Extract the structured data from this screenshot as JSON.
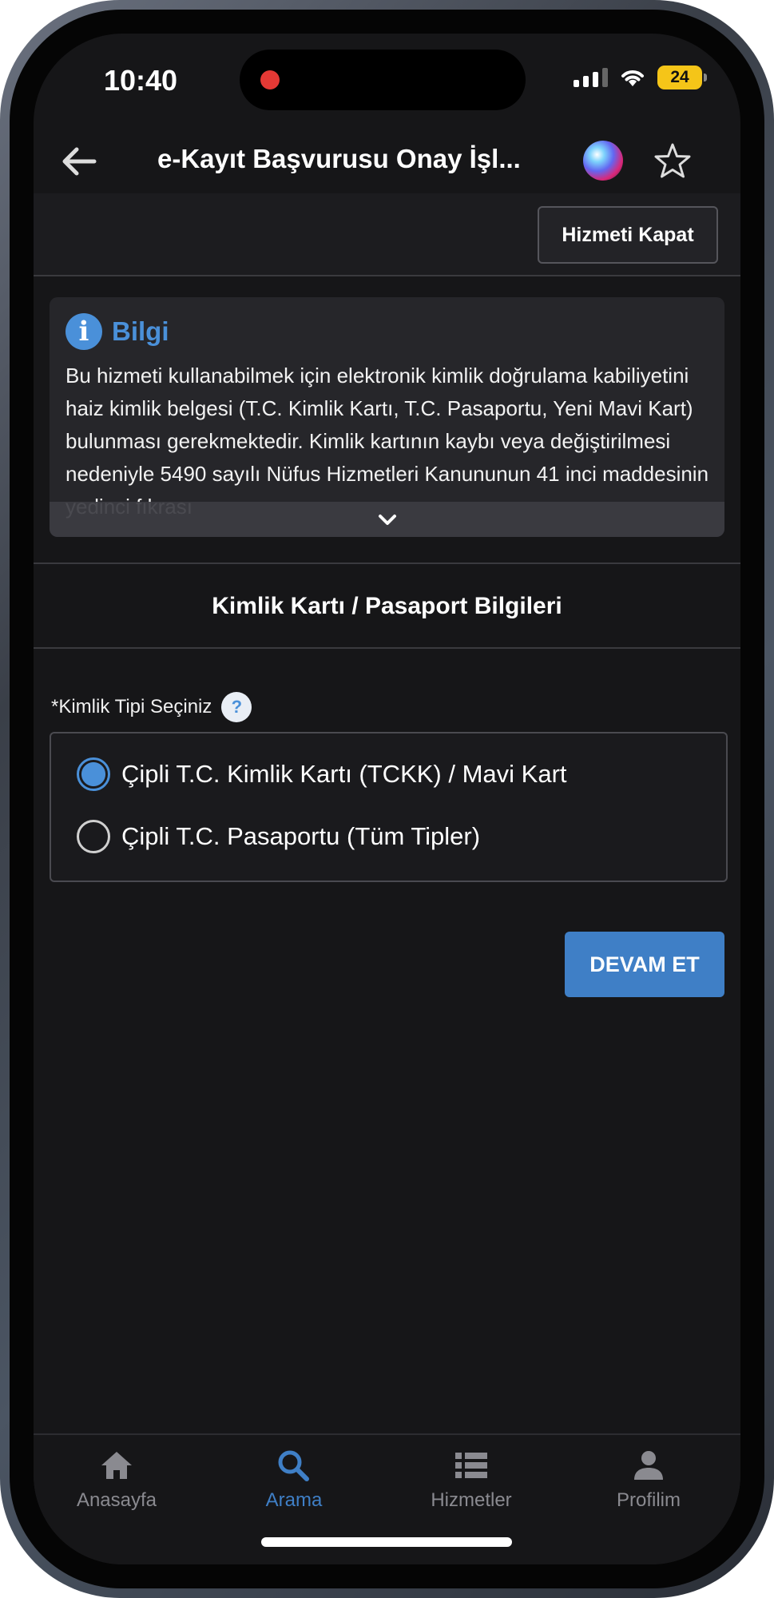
{
  "status_bar": {
    "time": "10:40",
    "battery": "24",
    "recording_indicator_color": "#e53935"
  },
  "header": {
    "title": "e-Kayıt Başvurusu Onay İşl...",
    "back_icon": "arrow-left-icon",
    "assistant_icon": "siri-orb-icon",
    "favorite_icon": "star-outline-icon"
  },
  "toolbar": {
    "close_service_label": "Hizmeti Kapat"
  },
  "info_card": {
    "title": "Bilgi",
    "icon": "info-icon",
    "text": "Bu hizmeti kullanabilmek için elektronik kimlik doğrulama kabiliyetini haiz kimlik belgesi (T.C. Kimlik Kartı, T.C. Pasaportu, Yeni Mavi Kart) bulunması gerekmektedir. Kimlik kartının kaybı veya değiştirilmesi nedeniyle 5490 sayılı Nüfus Hizmetleri Kanununun 41 inci maddesinin yedinci fıkrası",
    "expand_icon": "chevron-down-icon"
  },
  "section": {
    "title": "Kimlik Kartı / Pasaport Bilgileri"
  },
  "form": {
    "id_type_label": "*Kimlik Tipi Seçiniz",
    "help_label": "?",
    "options": [
      {
        "label": "Çipli T.C. Kimlik Kartı (TCKK) / Mavi Kart",
        "selected": true
      },
      {
        "label": "Çipli T.C. Pasaportu (Tüm Tipler)",
        "selected": false
      }
    ],
    "continue_label": "DEVAM ET"
  },
  "tab_bar": {
    "items": [
      {
        "label": "Anasayfa",
        "icon": "home-icon",
        "active": false
      },
      {
        "label": "Arama",
        "icon": "search-icon",
        "active": true
      },
      {
        "label": "Hizmetler",
        "icon": "list-icon",
        "active": false
      },
      {
        "label": "Profilim",
        "icon": "user-icon",
        "active": false
      }
    ]
  },
  "colors": {
    "accent": "#3f7fc6",
    "info_blue": "#4a90d9",
    "background": "#161618",
    "battery": "#f5c518"
  }
}
